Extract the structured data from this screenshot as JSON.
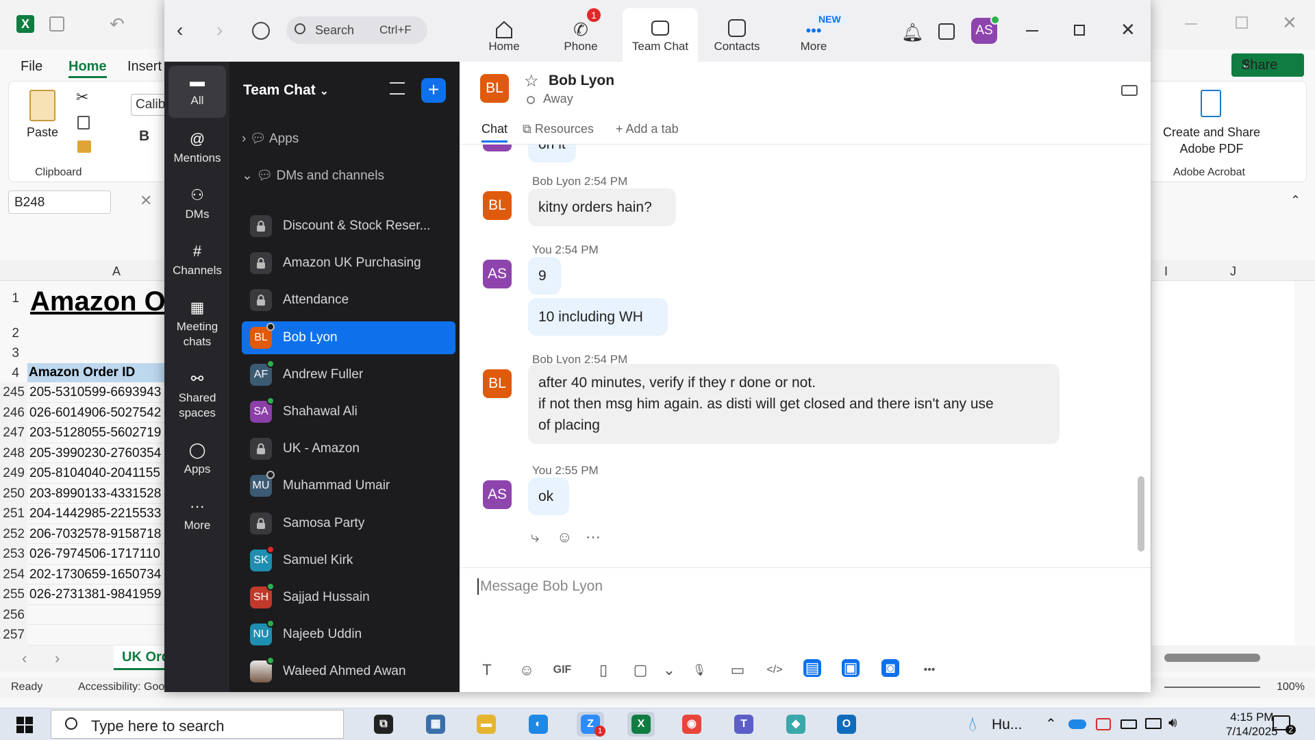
{
  "excel": {
    "menu": {
      "file": "File",
      "home": "Home",
      "insert": "Insert",
      "share": "Share"
    },
    "clipboard": {
      "paste": "Paste",
      "group": "Clipboard",
      "font": "Calibri",
      "bold": "B"
    },
    "adobe": {
      "create": "Create and Share",
      "pdf": "Adobe PDF",
      "group": "Adobe Acrobat"
    },
    "namebox": "B248",
    "col_a": "A",
    "col_i": "I",
    "col_j": "J",
    "title_row": {
      "num": "1",
      "text": "Amazon O"
    },
    "header_row": {
      "num": "4",
      "text": "Amazon Order ID"
    },
    "blank_rows": [
      "2",
      "3"
    ],
    "rows": [
      {
        "num": "245",
        "id": "205-5310599-6693943"
      },
      {
        "num": "246",
        "id": "026-6014906-5027542"
      },
      {
        "num": "247",
        "id": "203-5128055-5602719"
      },
      {
        "num": "248",
        "id": "205-3990230-2760354"
      },
      {
        "num": "249",
        "id": "205-8104040-2041155"
      },
      {
        "num": "250",
        "id": "203-8990133-4331528"
      },
      {
        "num": "251",
        "id": "204-1442985-2215533"
      },
      {
        "num": "252",
        "id": "206-7032578-9158718"
      },
      {
        "num": "253",
        "id": "026-7974506-1717110"
      },
      {
        "num": "254",
        "id": "202-1730659-1650734"
      },
      {
        "num": "255",
        "id": "026-2731381-9841959"
      },
      {
        "num": "256",
        "id": ""
      },
      {
        "num": "257",
        "id": ""
      }
    ],
    "sheet_tab": "UK Ord",
    "status": {
      "ready": "Ready",
      "accessibility": "Accessibility: Good to go",
      "zoom": "100%"
    }
  },
  "zoom": {
    "search": {
      "placeholder": "Search",
      "shortcut": "Ctrl+F"
    },
    "nav": [
      {
        "label": "Home",
        "badge": ""
      },
      {
        "label": "Phone",
        "badge": "1"
      },
      {
        "label": "Team Chat",
        "badge": ""
      },
      {
        "label": "Contacts",
        "badge": ""
      },
      {
        "label": "More",
        "badge": "NEW"
      }
    ],
    "user_initials": "AS",
    "rail": [
      {
        "label": "All"
      },
      {
        "label": "Mentions"
      },
      {
        "label": "DMs"
      },
      {
        "label": "Channels"
      },
      {
        "label": "Meeting chats"
      },
      {
        "label": "Shared spaces"
      },
      {
        "label": "Apps"
      },
      {
        "label": "More"
      }
    ],
    "list_title": "Team Chat",
    "sections": {
      "apps": "Apps",
      "dms": "DMs and channels"
    },
    "items": [
      {
        "name": "Discount & Stock Reser...",
        "initials": "",
        "color": "",
        "status": ""
      },
      {
        "name": "Amazon UK Purchasing",
        "initials": "",
        "color": "",
        "status": ""
      },
      {
        "name": "Attendance",
        "initials": "",
        "color": "",
        "status": ""
      },
      {
        "name": "Bob Lyon",
        "initials": "BL",
        "color": "#e05a0c",
        "status": "away"
      },
      {
        "name": "Andrew Fuller",
        "initials": "AF",
        "color": "#3d5a73",
        "status": "online"
      },
      {
        "name": "Shahawal Ali",
        "initials": "SA",
        "color": "#8b3fa8",
        "status": "online"
      },
      {
        "name": "UK - Amazon",
        "initials": "",
        "color": "",
        "status": ""
      },
      {
        "name": "Muhammad Umair",
        "initials": "MU",
        "color": "#3d5a73",
        "status": "away"
      },
      {
        "name": "Samosa Party",
        "initials": "",
        "color": "",
        "status": ""
      },
      {
        "name": "Samuel Kirk",
        "initials": "SK",
        "color": "#1e8fb0",
        "status": "busy"
      },
      {
        "name": "Sajjad Hussain",
        "initials": "SH",
        "color": "#c0392b",
        "status": "online"
      },
      {
        "name": "Najeeb Uddin",
        "initials": "NU",
        "color": "#1e8fb0",
        "status": "online"
      },
      {
        "name": "Waleed Ahmed Awan",
        "initials": "",
        "color": "#888",
        "status": "online"
      }
    ],
    "chat": {
      "contact": "Bob Lyon",
      "contact_initials": "BL",
      "presence": "Away",
      "tabs": {
        "chat": "Chat",
        "resources": "Resources",
        "add": "Add a tab"
      },
      "partial_bubble": "on it",
      "messages": [
        {
          "sender": "Bob Lyon 2:54 PM",
          "initials": "BL",
          "lines": [
            "kitny orders hain?"
          ]
        },
        {
          "sender": "You 2:54 PM",
          "initials": "AS",
          "lines": [
            "9"
          ]
        },
        {
          "sender": "",
          "initials": "",
          "lines": [
            "10 including WH"
          ]
        },
        {
          "sender": "Bob Lyon 2:54 PM",
          "initials": "BL",
          "lines": [
            "after 40 minutes, verify if they r done or not.",
            "if not then msg him again. as disti will get closed and there isn't any use",
            "of placing"
          ]
        },
        {
          "sender": "You 2:55 PM",
          "initials": "AS",
          "lines": [
            "ok"
          ]
        }
      ],
      "composer_placeholder": "Message Bob Lyon",
      "gif": "GIF"
    }
  },
  "taskbar": {
    "search": "Type here to search",
    "weather": "Hu...",
    "time": "4:15 PM",
    "date": "7/14/2025",
    "notif": "2",
    "zoom_badge": "1"
  },
  "colors": {
    "accent": "#0e71eb",
    "excel_green": "#107c41",
    "you_avatar": "#8e44ad",
    "bob_avatar": "#e05a0c",
    "badge_red": "#e02828"
  }
}
